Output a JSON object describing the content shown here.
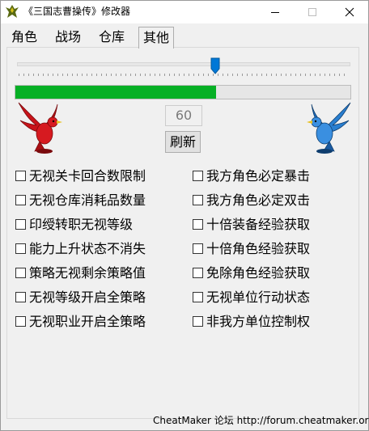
{
  "window": {
    "title": "《三国志曹操传》修改器",
    "minimize_icon": "minimize-icon",
    "maximize_icon": "maximize-icon",
    "close_icon": "close-icon"
  },
  "tabs": [
    {
      "label": "角色",
      "active": false
    },
    {
      "label": "战场",
      "active": false
    },
    {
      "label": "仓库",
      "active": false
    },
    {
      "label": "其他",
      "active": true
    }
  ],
  "slider": {
    "value_fraction": 0.6
  },
  "progress": {
    "percent": 60,
    "color": "#06b025"
  },
  "value_box": {
    "value": "60"
  },
  "refresh_button": {
    "label": "刷新"
  },
  "birds": {
    "left_color": "#c8141a",
    "right_color": "#1f6fc0"
  },
  "options_left": [
    {
      "label": "无视关卡回合数限制",
      "checked": false
    },
    {
      "label": "无视仓库消耗品数量",
      "checked": false
    },
    {
      "label": "印绶转职无视等级",
      "checked": false
    },
    {
      "label": "能力上升状态不消失",
      "checked": false
    },
    {
      "label": "策略无视剩余策略值",
      "checked": false
    },
    {
      "label": "无视等级开启全策略",
      "checked": false
    },
    {
      "label": "无视职业开启全策略",
      "checked": false
    }
  ],
  "options_right": [
    {
      "label": "我方角色必定暴击",
      "checked": false
    },
    {
      "label": "我方角色必定双击",
      "checked": false
    },
    {
      "label": "十倍装备经验获取",
      "checked": false
    },
    {
      "label": "十倍角色经验获取",
      "checked": false
    },
    {
      "label": "免除角色经验获取",
      "checked": false
    },
    {
      "label": "无视单位行动状态",
      "checked": false
    },
    {
      "label": "非我方单位控制权",
      "checked": false
    }
  ],
  "footer": {
    "text": "CheatMaker 论坛 http://forum.cheatmaker.org/"
  }
}
